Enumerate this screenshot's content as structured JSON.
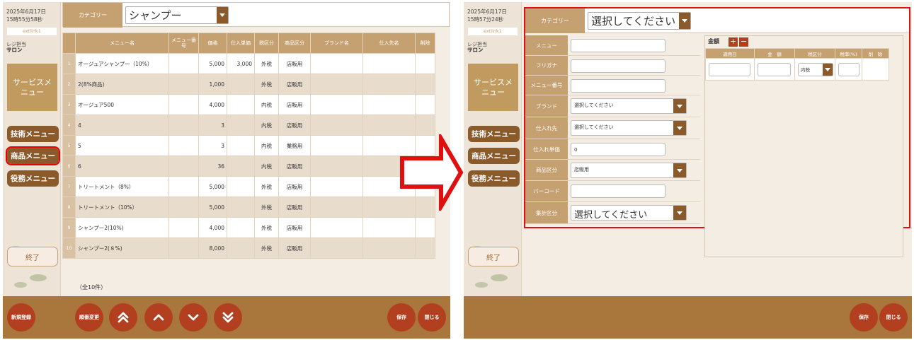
{
  "left": {
    "datetime_line1": "2025年6月17日",
    "datetime_line2": "15時55分58秒",
    "ext": "extlink1",
    "staff_label": "レジ担当",
    "staff_name": "サロン",
    "service_menu": "サービスメニュー",
    "menus": [
      "技術メニュー",
      "商品メニュー",
      "役務メニュー"
    ],
    "end_button": "終了",
    "category_label": "カテゴリー",
    "category_value": "シャンプー",
    "columns": [
      "",
      "メニュー名",
      "メニュー番号",
      "価格",
      "仕入単価",
      "税区分",
      "商品区分",
      "ブランド名",
      "仕入先名",
      "削除"
    ],
    "rows": [
      [
        "1",
        "オージュアシャンプー（10%）",
        "",
        "5,000",
        "3,000",
        "外税",
        "店販用",
        "",
        "",
        ""
      ],
      [
        "2",
        "2(8%商品)",
        "",
        "1,000",
        "",
        "外税",
        "店販用",
        "",
        "",
        ""
      ],
      [
        "3",
        "オージュア500",
        "",
        "4,000",
        "",
        "内税",
        "店販用",
        "",
        "",
        ""
      ],
      [
        "4",
        "4",
        "",
        "3",
        "",
        "内税",
        "店販用",
        "",
        "",
        ""
      ],
      [
        "5",
        "5",
        "",
        "3",
        "",
        "内税",
        "業務用",
        "",
        "",
        ""
      ],
      [
        "6",
        "6",
        "",
        "36",
        "",
        "内税",
        "店販用",
        "",
        "",
        ""
      ],
      [
        "7",
        "トリートメント（8%）",
        "",
        "5,000",
        "",
        "外税",
        "店販用",
        "",
        "",
        ""
      ],
      [
        "8",
        "トリートメント（10%）",
        "",
        "5,000",
        "",
        "外税",
        "店販用",
        "",
        "",
        ""
      ],
      [
        "9",
        "シャンプー2(10%)",
        "",
        "4,000",
        "",
        "外税",
        "店販用",
        "",
        "",
        ""
      ],
      [
        "10",
        "シャンプー2(８%)",
        "",
        "8,000",
        "",
        "外税",
        "店販用",
        "",
        "",
        ""
      ]
    ],
    "count": "（全10件）",
    "buttons": {
      "new": "新規登録",
      "order": "順番変更",
      "save": "保存",
      "close": "閉じる"
    }
  },
  "right": {
    "datetime_line1": "2025年6月17日",
    "datetime_line2": "15時57分24秒",
    "ext": "extlink1",
    "staff_label": "レジ担当",
    "staff_name": "サロン",
    "service_menu": "サービスメニュー",
    "menus": [
      "技術メニュー",
      "商品メニュー",
      "役務メニュー"
    ],
    "end_button": "終了",
    "category_label": "カテゴリー",
    "category_value": "選択してください",
    "fields": [
      {
        "label": "メニュー",
        "value": ""
      },
      {
        "label": "フリガナ",
        "value": ""
      },
      {
        "label": "メニュー番号",
        "value": ""
      },
      {
        "label": "ブランド",
        "value": "選択してください"
      },
      {
        "label": "仕入れ先",
        "value": "選択してください"
      },
      {
        "label": "仕入れ単価",
        "value": "0"
      },
      {
        "label": "商品区分",
        "value": "店販用"
      },
      {
        "label": "バーコード",
        "value": ""
      },
      {
        "label": "集計区分",
        "value": "選択してください"
      }
    ],
    "price_title": "金額",
    "price_columns": [
      "適用日",
      "金　額",
      "税区分",
      "税率(%)",
      "削　除"
    ],
    "tax_value": "内税",
    "buttons": {
      "save": "保存",
      "close": "閉じる"
    }
  }
}
